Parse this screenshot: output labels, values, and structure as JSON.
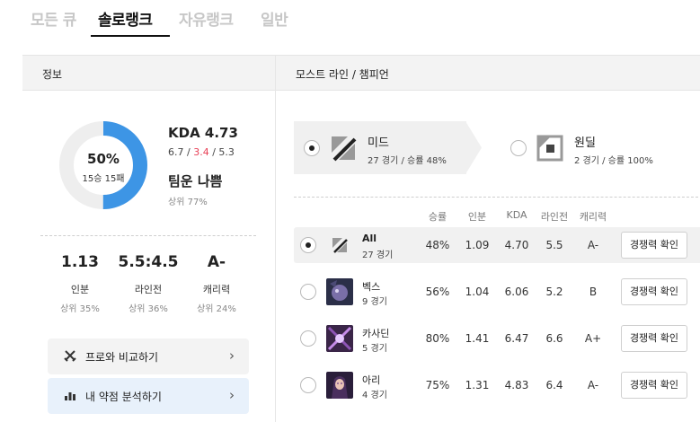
{
  "tabs": [
    {
      "label": "모든 큐"
    },
    {
      "label": "솔로랭크"
    },
    {
      "label": "자유랭크"
    },
    {
      "label": "일반"
    }
  ],
  "info": {
    "header": "정보",
    "winrate": "50%",
    "record": "15승 15패",
    "winrate_value": 50,
    "kda_title": "KDA 4.73",
    "kills": "6.7",
    "deaths": "3.4",
    "assists": "5.3",
    "team_title": "팀운 나쁨",
    "team_sub": "상위 77%",
    "stats": [
      {
        "value": "1.13",
        "label": "인분",
        "sub": "상위 35%"
      },
      {
        "value": "5.5:4.5",
        "label": "라인전",
        "sub": "상위 36%"
      },
      {
        "value": "A-",
        "label": "캐리력",
        "sub": "상위 24%"
      }
    ],
    "compare_pro": "프로와 비교하기",
    "weakness": "내 약점 분석하기"
  },
  "lanes": {
    "header": "모스트 라인 / 챔피언",
    "cards": [
      {
        "name": "미드",
        "sub": "27 경기 / 승률 48%",
        "selected": true
      },
      {
        "name": "원딜",
        "sub": "2 경기 / 승률 100%",
        "selected": false
      }
    ],
    "columns": [
      "승률",
      "인분",
      "KDA",
      "라인전",
      "캐리력"
    ],
    "rows": [
      {
        "name": "All",
        "games": "27 경기",
        "winrate": "48%",
        "inbun": "1.09",
        "kda": "4.70",
        "lane": "5.5",
        "carry": "A-",
        "button": "경쟁력 확인",
        "selected": true
      },
      {
        "name": "벡스",
        "games": "9 경기",
        "winrate": "56%",
        "inbun": "1.04",
        "kda": "6.06",
        "lane": "5.2",
        "carry": "B",
        "button": "경쟁력 확인",
        "selected": false
      },
      {
        "name": "카사딘",
        "games": "5 경기",
        "winrate": "80%",
        "inbun": "1.41",
        "kda": "6.47",
        "lane": "6.6",
        "carry": "A+",
        "button": "경쟁력 확인",
        "selected": false
      },
      {
        "name": "아리",
        "games": "4 경기",
        "winrate": "75%",
        "inbun": "1.31",
        "kda": "4.83",
        "lane": "6.4",
        "carry": "A-",
        "button": "경쟁력 확인",
        "selected": false
      }
    ]
  },
  "colors": {
    "accent": "#3d95e5",
    "deaths": "#e84057"
  }
}
